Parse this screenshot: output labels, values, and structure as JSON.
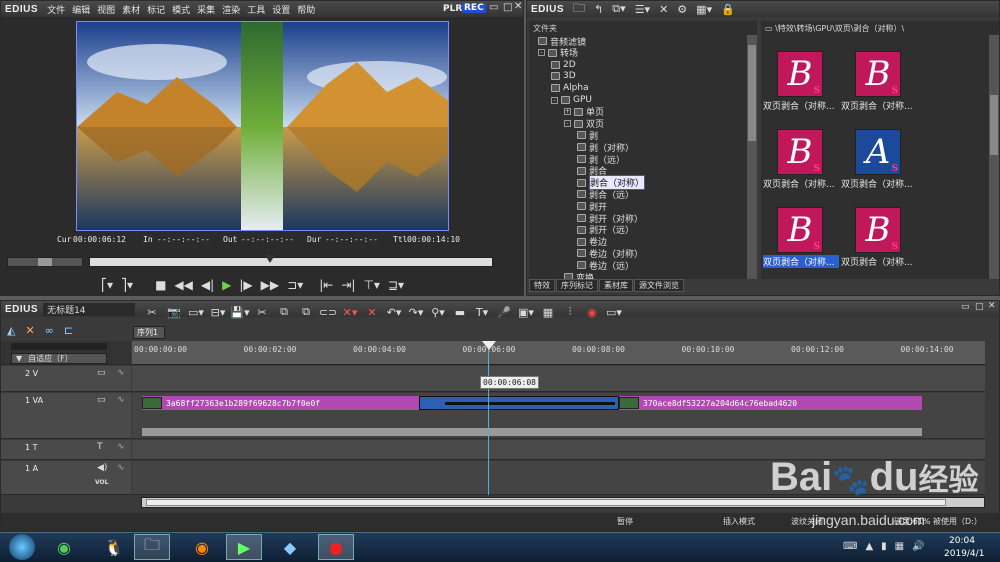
{
  "player": {
    "logo": "EDIUS",
    "menu": [
      "文件",
      "编辑",
      "视图",
      "素材",
      "标记",
      "模式",
      "采集",
      "渲染",
      "工具",
      "设置",
      "帮助"
    ],
    "plr": "PLR",
    "rec": "REC",
    "tc": {
      "cur_label": "Cur",
      "cur": "00:00:06:12",
      "in_label": "In",
      "in": "--:--:--:--",
      "out_label": "Out",
      "out": "--:--:--:--",
      "dur_label": "Dur",
      "dur": "--:--:--:--",
      "ttl_label": "Ttl",
      "ttl": "00:00:14:10"
    }
  },
  "effects": {
    "logo": "EDIUS",
    "folder_header": "文件夹",
    "path": "\\特效\\转场\\GPU\\双页\\剥合（对称）\\",
    "tree": [
      {
        "label": "音频滤镜",
        "indent": 1
      },
      {
        "label": "转场",
        "indent": 1,
        "pm": "-"
      },
      {
        "label": "2D",
        "indent": 2
      },
      {
        "label": "3D",
        "indent": 2
      },
      {
        "label": "Alpha",
        "indent": 2
      },
      {
        "label": "GPU",
        "indent": 2,
        "pm": "-"
      },
      {
        "label": "单页",
        "indent": 3,
        "pm": "+"
      },
      {
        "label": "双页",
        "indent": 3,
        "pm": "-"
      },
      {
        "label": "剥",
        "indent": 4
      },
      {
        "label": "剥（对称）",
        "indent": 4
      },
      {
        "label": "剥（远）",
        "indent": 4
      },
      {
        "label": "剥合",
        "indent": 4
      },
      {
        "label": "剥合（对称）",
        "indent": 4,
        "selected": true
      },
      {
        "label": "剥合（远）",
        "indent": 4
      },
      {
        "label": "剥开",
        "indent": 4
      },
      {
        "label": "剥开（对称）",
        "indent": 4
      },
      {
        "label": "剥开（远）",
        "indent": 4
      },
      {
        "label": "卷边",
        "indent": 4
      },
      {
        "label": "卷边（对称）",
        "indent": 4
      },
      {
        "label": "卷边（远）",
        "indent": 4
      },
      {
        "label": "变换",
        "indent": 3
      }
    ],
    "thumbs": [
      {
        "letter": "B",
        "s": "S",
        "caption": "双页剥合（对称...",
        "blue": false
      },
      {
        "letter": "B",
        "s": "S",
        "caption": "双页剥合（对称...",
        "blue": false
      },
      {
        "letter": "B",
        "s": "S",
        "caption": "双页剥合（对称...",
        "blue": false
      },
      {
        "letter": "A",
        "s": "S",
        "caption": "双页剥合（对称...",
        "blue": true
      },
      {
        "letter": "B",
        "s": "S",
        "caption": "双页剥合（对称...",
        "blue": false,
        "selected": true
      },
      {
        "letter": "B",
        "s": "S",
        "caption": "双页剥合（对称...",
        "blue": false
      }
    ],
    "tabs": [
      "特效",
      "序列标记",
      "素材库",
      "源文件浏览"
    ]
  },
  "timeline": {
    "logo": "EDIUS",
    "project": "无标题14",
    "seq_tab": "序列1",
    "mode": "自适应（F）",
    "ruler": [
      "00:00:00:00",
      "00:00:02:00",
      "00:00:04:00",
      "00:00:06:00",
      "00:00:08:00",
      "00:00:10:00",
      "00:00:12:00",
      "00:00:14:00"
    ],
    "playhead_tc": "00:00:06:08",
    "tracks": [
      {
        "name": "2 V"
      },
      {
        "name": "1 VA"
      },
      {
        "name": "1 T"
      },
      {
        "name": "1 A",
        "vol": "VOL"
      }
    ],
    "clip1": "3a68ff27363e1b289f69628c7b7f0e0f",
    "clip2": "370ace8df53227a204d64c76ebad4620",
    "status": {
      "pause": "暂停",
      "insert": "插入模式",
      "ripple": "波纹关闭",
      "disk": "磁盘:61% 被使用（D:）"
    }
  },
  "taskbar": {
    "time": "20:04",
    "date": "2019/4/1"
  },
  "watermark": {
    "main": "Bai",
    "du": "du",
    "jy": "经验",
    "url": "jingyan.baidu.com"
  }
}
